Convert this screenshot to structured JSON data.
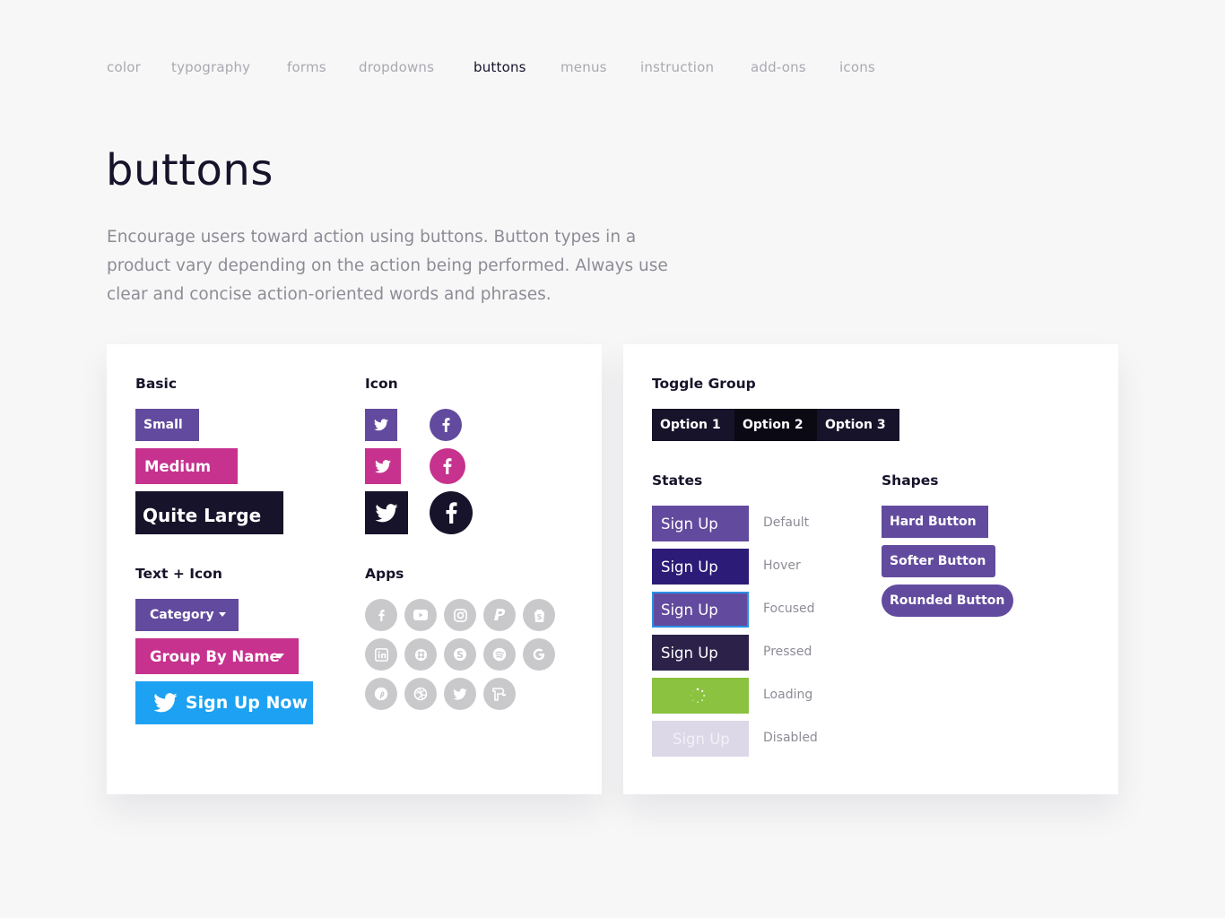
{
  "nav": {
    "items": [
      "color",
      "typography",
      "forms",
      "dropdowns",
      "buttons",
      "menus",
      "instruction",
      "add-ons",
      "icons"
    ],
    "active": "buttons"
  },
  "page": {
    "title": "buttons",
    "intro": "Encourage users toward action using buttons. Button types in a product vary depending on the action being performed. Always use clear and concise action-oriented words and phrases."
  },
  "basic": {
    "heading": "Basic",
    "small": "Small",
    "medium": "Medium",
    "large": "Quite Large"
  },
  "icon": {
    "heading": "Icon",
    "rows": [
      {
        "color": "#624b9e",
        "twitter": "twitter-icon",
        "facebook": "facebook-icon"
      },
      {
        "color": "#c6328e",
        "twitter": "twitter-icon",
        "facebook": "facebook-icon"
      },
      {
        "color": "#16132a",
        "twitter": "twitter-icon",
        "facebook": "facebook-icon"
      }
    ]
  },
  "text_icon": {
    "heading": "Text + Icon",
    "category": "Category",
    "group_by": "Group By Name",
    "signup_now": "Sign Up Now"
  },
  "apps": {
    "heading": "Apps",
    "icons": [
      "facebook-icon",
      "youtube-icon",
      "instagram-icon",
      "paypal-icon",
      "shopify-icon",
      "linkedin-icon",
      "slack-icon",
      "skype-icon",
      "spotify-icon",
      "google-icon",
      "pinterest-icon",
      "dribbble-icon",
      "twitter-icon",
      "dropbox-paper-icon"
    ]
  },
  "toggle_group": {
    "heading": "Toggle Group",
    "options": [
      "Option 1",
      "Option 2",
      "Option 3"
    ],
    "selected": "Option 2"
  },
  "states": {
    "heading": "States",
    "items": [
      {
        "button": "Sign Up",
        "label": "Default",
        "color": "#624b9e"
      },
      {
        "button": "Sign Up",
        "label": "Hover",
        "color": "#2d1b78"
      },
      {
        "button": "Sign Up",
        "label": "Focused",
        "color": "#624b9e"
      },
      {
        "button": "Sign Up",
        "label": "Pressed",
        "color": "#2c2249"
      },
      {
        "button": "",
        "label": "Loading",
        "color": "#8bc23f"
      },
      {
        "button": "Sign Up",
        "label": "Disabled",
        "color": "#dcd8e8"
      }
    ]
  },
  "shapes": {
    "heading": "Shapes",
    "hard": "Hard Button",
    "softer": "Softer Button",
    "rounded": "Rounded Button"
  },
  "colors": {
    "purple": "#624b9e",
    "magenta": "#c6328e",
    "dark": "#16132a",
    "twitter_blue": "#1da1f2",
    "focus_ring": "#2a8fe5"
  }
}
